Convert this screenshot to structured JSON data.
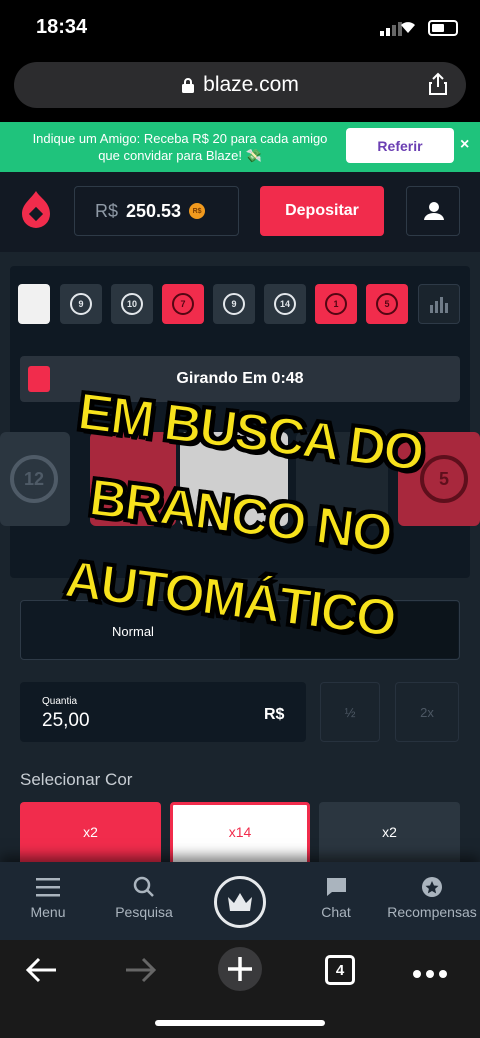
{
  "status": {
    "time": "18:34"
  },
  "browser": {
    "url": "blaze.com",
    "tabs_count": "4"
  },
  "promo": {
    "text": "Indique um Amigo: Receba R$ 20 para cada amigo que convidar para Blaze! 💸",
    "button": "Referir",
    "close": "×"
  },
  "header": {
    "currency": "R$",
    "balance": "250.53",
    "coin": "R$",
    "deposit": "Depositar"
  },
  "history": [
    {
      "n": "",
      "color": "white"
    },
    {
      "n": "9",
      "color": "black"
    },
    {
      "n": "10",
      "color": "black"
    },
    {
      "n": "7",
      "color": "red"
    },
    {
      "n": "9",
      "color": "black"
    },
    {
      "n": "14",
      "color": "black"
    },
    {
      "n": "1",
      "color": "red"
    },
    {
      "n": "5",
      "color": "red"
    }
  ],
  "timer": {
    "label": "Girando Em 0:48"
  },
  "roulette": {
    "left_number": "12",
    "right_number": "5"
  },
  "overlay": {
    "line1": "EM BUSCA DO",
    "line2": "BRANCO NO",
    "line3": "AUTOMÁTICO"
  },
  "mode": {
    "normal": "Normal"
  },
  "bet": {
    "label": "Quantia",
    "value": "25,00",
    "currency": "R$",
    "half": "½",
    "double": "2x"
  },
  "select_color": {
    "title": "Selecionar Cor",
    "red": "x2",
    "white": "x14",
    "black": "x2"
  },
  "nav": {
    "menu": "Menu",
    "search": "Pesquisa",
    "chat": "Chat",
    "rewards": "Recompensas"
  },
  "colors": {
    "red": "#f12c4c",
    "green": "#1fc37c",
    "dark": "#0f1923",
    "overlay_yellow": "#f7e21c"
  }
}
